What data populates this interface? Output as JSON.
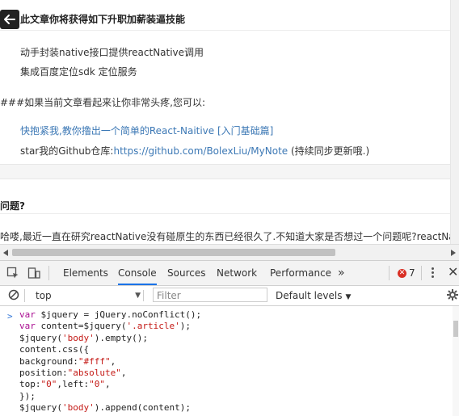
{
  "article": {
    "heading": "此文章你将获得如下升职加薪装逼技能",
    "skill_1": "动手封装native接口提供reactNative调用",
    "skill_2": "集成百度定位sdk 定位服务",
    "note": "###如果当前文章看起来让你非常头疼,您可以:",
    "link_1": "快抱紧我,教你撸出一个简单的React-Naitive [入门基础篇]",
    "github_prefix": "star我的Github仓库:",
    "github_url": "https://github.com/BolexLiu/MyNote",
    "github_suffix": " (持续同步更新哦.)",
    "section_title": "问题?",
    "para": "哈喽,最近一直在研究reactNative没有碰原生的东西已经很久了.不知道大家是否想过一个问题呢?reactNati"
  },
  "devtools": {
    "tabs": [
      "Elements",
      "Console",
      "Sources",
      "Network",
      "Performance"
    ],
    "active_tab": "Console",
    "more_tabs": "»",
    "error_count": "7",
    "context": "top",
    "filter_placeholder": "Filter",
    "levels": "Default levels",
    "prompt": ">"
  },
  "colors": {
    "link": "#3c78b5",
    "active_tab": "#1a73e8",
    "keyword": "#aa0d91",
    "string": "#c41a16"
  },
  "icons": [
    "back-arrow-icon",
    "inspect-icon",
    "device-toggle-icon",
    "error-icon",
    "more-icon",
    "close-icon",
    "clear-console-icon",
    "settings-gear-icon"
  ]
}
